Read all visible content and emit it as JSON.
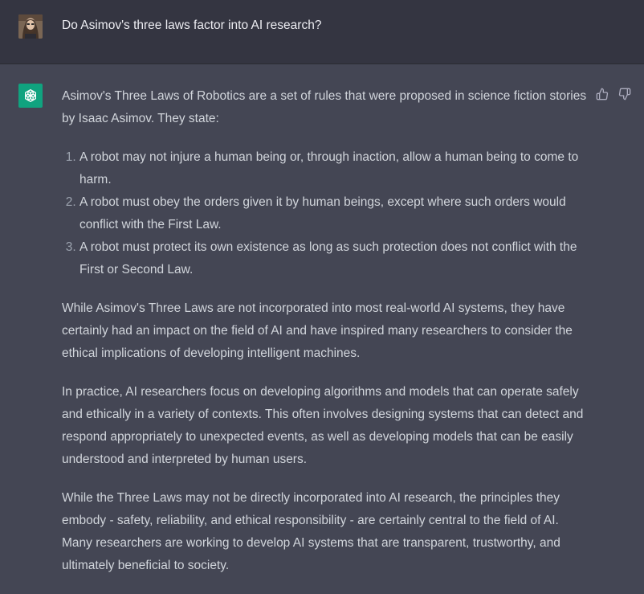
{
  "user_message": {
    "text": "Do Asimov's three laws factor into AI research?"
  },
  "assistant_message": {
    "intro": "Asimov's Three Laws of Robotics are a set of rules that were proposed in science fiction stories by Isaac Asimov. They state:",
    "laws": [
      "A robot may not injure a human being or, through inaction, allow a human being to come to harm.",
      "A robot must obey the orders given it by human beings, except where such orders would conflict with the First Law.",
      "A robot must protect its own existence as long as such protection does not conflict with the First or Second Law."
    ],
    "paragraphs": [
      "While Asimov's Three Laws are not incorporated into most real-world AI systems, they have certainly had an impact on the field of AI and have inspired many researchers to consider the ethical implications of developing intelligent machines.",
      "In practice, AI researchers focus on developing algorithms and models that can operate safely and ethically in a variety of contexts. This often involves designing systems that can detect and respond appropriately to unexpected events, as well as developing models that can be easily understood and interpreted by human users.",
      "While the Three Laws may not be directly incorporated into AI research, the principles they embody - safety, reliability, and ethical responsibility - are certainly central to the field of AI. Many researchers are working to develop AI systems that are transparent, trustworthy, and ultimately beneficial to society."
    ]
  },
  "icons": {
    "user_avatar": "user-avatar",
    "bot_avatar": "openai-logo-icon",
    "thumbs_up": "thumbs-up-icon",
    "thumbs_down": "thumbs-down-icon"
  },
  "colors": {
    "page_bg": "#444654",
    "user_row_bg": "#343541",
    "bot_avatar_bg": "#10a37f",
    "text": "#d1d5db"
  }
}
